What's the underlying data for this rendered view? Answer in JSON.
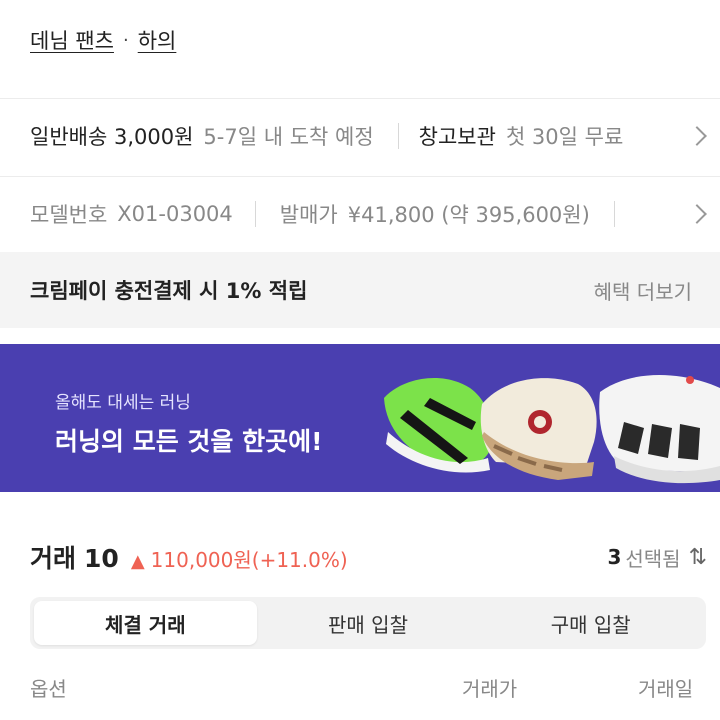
{
  "breadcrumb": {
    "items": [
      "데님 팬츠",
      "하의"
    ],
    "separator": "·"
  },
  "shipping": {
    "method": "일반배송 3,000원",
    "eta": "5-7일 내 도착 예정",
    "storage_label": "창고보관",
    "storage_desc": "첫 30일 무료"
  },
  "product_info": {
    "model_label": "모델번호",
    "model_value": "X01-03004",
    "release_label": "발매가",
    "release_value": "¥41,800 (약 395,600원)"
  },
  "benefit": {
    "title": "크림페이 충전결제 시 1% 적립",
    "more": "혜택 더보기"
  },
  "banner": {
    "subtitle": "올해도 대세는 러닝",
    "headline": "러닝의 모든 것을 한곳에!",
    "bg_color": "#4a3fb0"
  },
  "trades": {
    "label": "거래",
    "count": "10",
    "trend_icon": "▲",
    "change": "110,000원(+11.0%)",
    "selected_count": "3",
    "selected_label": "선택됨",
    "sort_icon": "⇅",
    "accent_color": "#ef6253"
  },
  "tabs": [
    {
      "label": "체결 거래",
      "active": true
    },
    {
      "label": "판매 입찰",
      "active": false
    },
    {
      "label": "구매 입찰",
      "active": false
    }
  ],
  "table_headers": {
    "option": "옵션",
    "price": "거래가",
    "date": "거래일"
  }
}
